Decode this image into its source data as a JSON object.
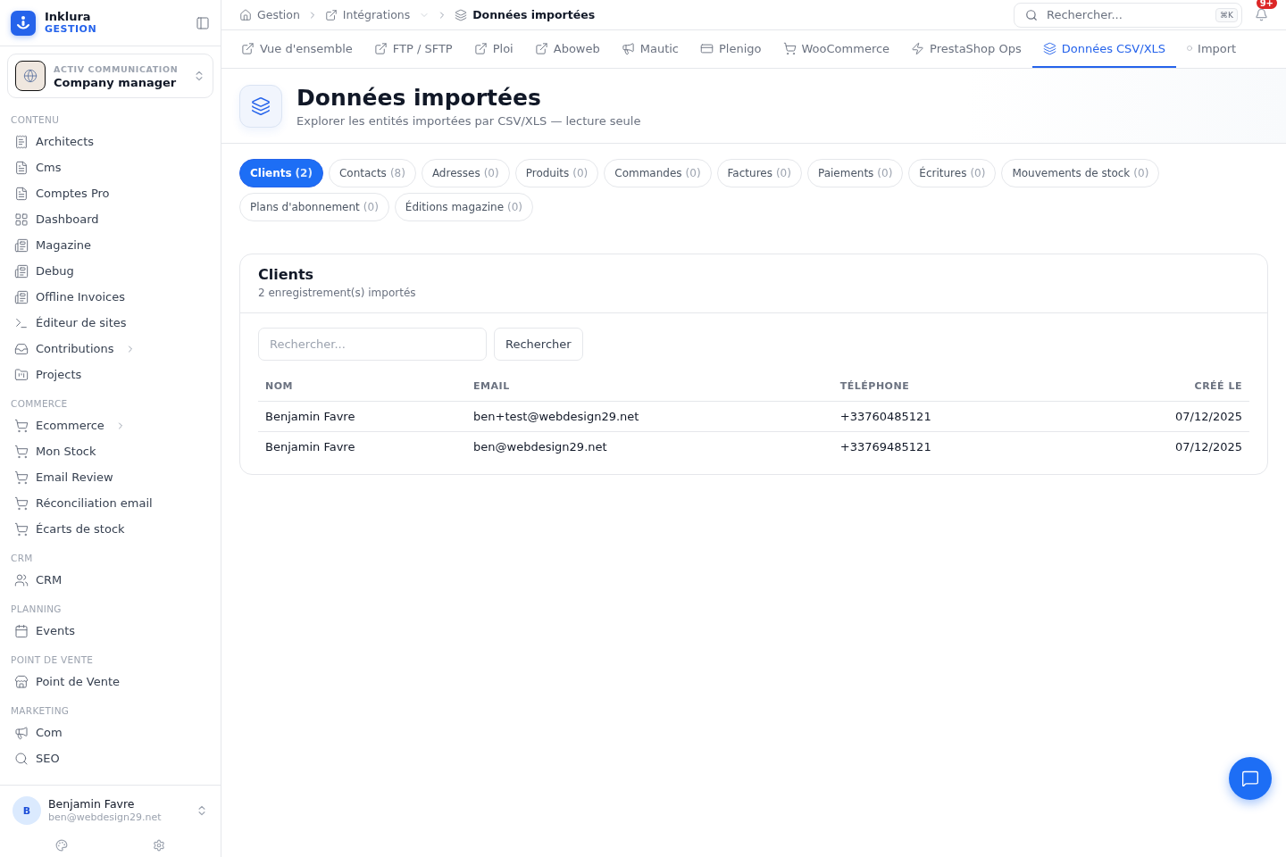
{
  "brand": {
    "name": "Inklura",
    "subtitle": "GESTION"
  },
  "org": {
    "company": "ACTIV COMMUNICATION",
    "role": "Company manager"
  },
  "sidebar": {
    "sections": [
      {
        "title": "CONTENU",
        "items": [
          {
            "label": "Architects",
            "kind": "receipt",
            "has_children": false
          },
          {
            "label": "Cms",
            "kind": "file",
            "has_children": false
          },
          {
            "label": "Comptes Pro",
            "kind": "file",
            "has_children": false
          },
          {
            "label": "Dashboard",
            "kind": "grid",
            "has_children": false
          },
          {
            "label": "Magazine",
            "kind": "newspaper",
            "has_children": false
          },
          {
            "label": "Debug",
            "kind": "newspaper",
            "has_children": false
          },
          {
            "label": "Offline Invoices",
            "kind": "newspaper",
            "has_children": false
          },
          {
            "label": "Éditeur de sites",
            "kind": "terminal",
            "has_children": false
          },
          {
            "label": "Contributions",
            "kind": "inbox",
            "has_children": true
          },
          {
            "label": "Projects",
            "kind": "folder",
            "has_children": false
          }
        ]
      },
      {
        "title": "COMMERCE",
        "items": [
          {
            "label": "Ecommerce",
            "kind": "cart",
            "has_children": true
          },
          {
            "label": "Mon Stock",
            "kind": "cart",
            "has_children": false
          },
          {
            "label": "Email Review",
            "kind": "cart",
            "has_children": false
          },
          {
            "label": "Réconciliation email",
            "kind": "cart",
            "has_children": false
          },
          {
            "label": "Écarts de stock",
            "kind": "cart",
            "has_children": false
          }
        ]
      },
      {
        "title": "CRM",
        "items": [
          {
            "label": "CRM",
            "kind": "users",
            "has_children": false
          }
        ]
      },
      {
        "title": "PLANNING",
        "items": [
          {
            "label": "Events",
            "kind": "calendar",
            "has_children": false
          }
        ]
      },
      {
        "title": "POINT DE VENTE",
        "items": [
          {
            "label": "Point de Vente",
            "kind": "store",
            "has_children": false
          }
        ]
      },
      {
        "title": "MARKETING",
        "items": [
          {
            "label": "Com",
            "kind": "megaphone",
            "has_children": false
          },
          {
            "label": "SEO",
            "kind": "search",
            "has_children": false
          }
        ]
      }
    ]
  },
  "user": {
    "initial": "B",
    "name": "Benjamin Favre",
    "email": "ben@webdesign29.net"
  },
  "breadcrumb": [
    {
      "label": "Gestion",
      "kind": "home"
    },
    {
      "label": "Intégrations",
      "kind": "link"
    },
    {
      "label": "Données importées",
      "kind": "layers"
    }
  ],
  "search": {
    "placeholder": "Rechercher...",
    "shortcut": "⌘K"
  },
  "notifications": {
    "badge": "9+"
  },
  "tabs": [
    {
      "label": "Vue d'ensemble",
      "kind": "link",
      "selected": false
    },
    {
      "label": "FTP / SFTP",
      "kind": "link",
      "selected": false
    },
    {
      "label": "Ploi",
      "kind": "link",
      "selected": false
    },
    {
      "label": "Aboweb",
      "kind": "link",
      "selected": false
    },
    {
      "label": "Mautic",
      "kind": "megaphone",
      "selected": false
    },
    {
      "label": "Plenigo",
      "kind": "card",
      "selected": false
    },
    {
      "label": "WooCommerce",
      "kind": "cart",
      "selected": false
    },
    {
      "label": "PrestaShop Ops",
      "kind": "zap",
      "selected": false
    },
    {
      "label": "Données CSV/XLS",
      "kind": "layers",
      "selected": true
    },
    {
      "label": "Import",
      "kind": "dot",
      "selected": false
    }
  ],
  "header": {
    "title": "Données importées",
    "subtitle": "Explorer les entités importées par CSV/XLS — lecture seule"
  },
  "entities": [
    {
      "label": "Clients",
      "count": "(2)",
      "selected": true
    },
    {
      "label": "Contacts",
      "count": "(8)",
      "selected": false
    },
    {
      "label": "Adresses",
      "count": "(0)",
      "selected": false
    },
    {
      "label": "Produits",
      "count": "(0)",
      "selected": false
    },
    {
      "label": "Commandes",
      "count": "(0)",
      "selected": false
    },
    {
      "label": "Factures",
      "count": "(0)",
      "selected": false
    },
    {
      "label": "Paiements",
      "count": "(0)",
      "selected": false
    },
    {
      "label": "Écritures",
      "count": "(0)",
      "selected": false
    },
    {
      "label": "Mouvements de stock",
      "count": "(0)",
      "selected": false
    },
    {
      "label": "Plans d'abonnement",
      "count": "(0)",
      "selected": false
    },
    {
      "label": "Éditions magazine",
      "count": "(0)",
      "selected": false
    }
  ],
  "card": {
    "title": "Clients",
    "subtitle": "2 enregistrement(s) importés",
    "search_placeholder": "Rechercher...",
    "search_button": "Rechercher",
    "table": {
      "columns": [
        "NOM",
        "EMAIL",
        "TÉLÉPHONE",
        "CRÉÉ LE"
      ],
      "rows": [
        [
          "Benjamin Favre",
          "ben+test@webdesign29.net",
          "+33760485121",
          "07/12/2025"
        ],
        [
          "Benjamin Favre",
          "ben@webdesign29.net",
          "+33769485121",
          "07/12/2025"
        ]
      ]
    }
  }
}
